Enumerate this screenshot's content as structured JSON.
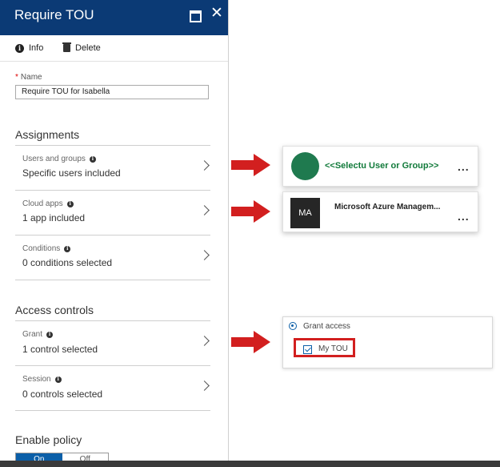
{
  "blade": {
    "title": "Require TOU",
    "toolbar": {
      "info_label": "Info",
      "delete_label": "Delete"
    },
    "name": {
      "label": "Name",
      "value": "Require TOU for Isabella"
    },
    "assignments": {
      "heading": "Assignments",
      "rows": [
        {
          "label": "Users and groups",
          "value": "Specific users included"
        },
        {
          "label": "Cloud apps",
          "value": "1 app included"
        },
        {
          "label": "Conditions",
          "value": "0 conditions selected"
        }
      ]
    },
    "access_controls": {
      "heading": "Access controls",
      "rows": [
        {
          "label": "Grant",
          "value": "1 control selected"
        },
        {
          "label": "Session",
          "value": "0 controls selected"
        }
      ]
    },
    "enable_policy": {
      "heading": "Enable policy",
      "on_label": "On",
      "off_label": "Off"
    }
  },
  "callouts": {
    "user_card": {
      "text": "<<Selectu User or Group>>",
      "more": "..."
    },
    "app_card": {
      "initials": "MA",
      "text": "Microsoft Azure Managem...",
      "more": "..."
    },
    "grant": {
      "grant_access_label": "Grant access",
      "tou_label": "My TOU"
    }
  },
  "colors": {
    "header_bg": "#0b3a75",
    "arrow_red": "#d21f1f",
    "avatar_green": "#1f7a4f",
    "accent_blue": "#0b5fa8"
  }
}
